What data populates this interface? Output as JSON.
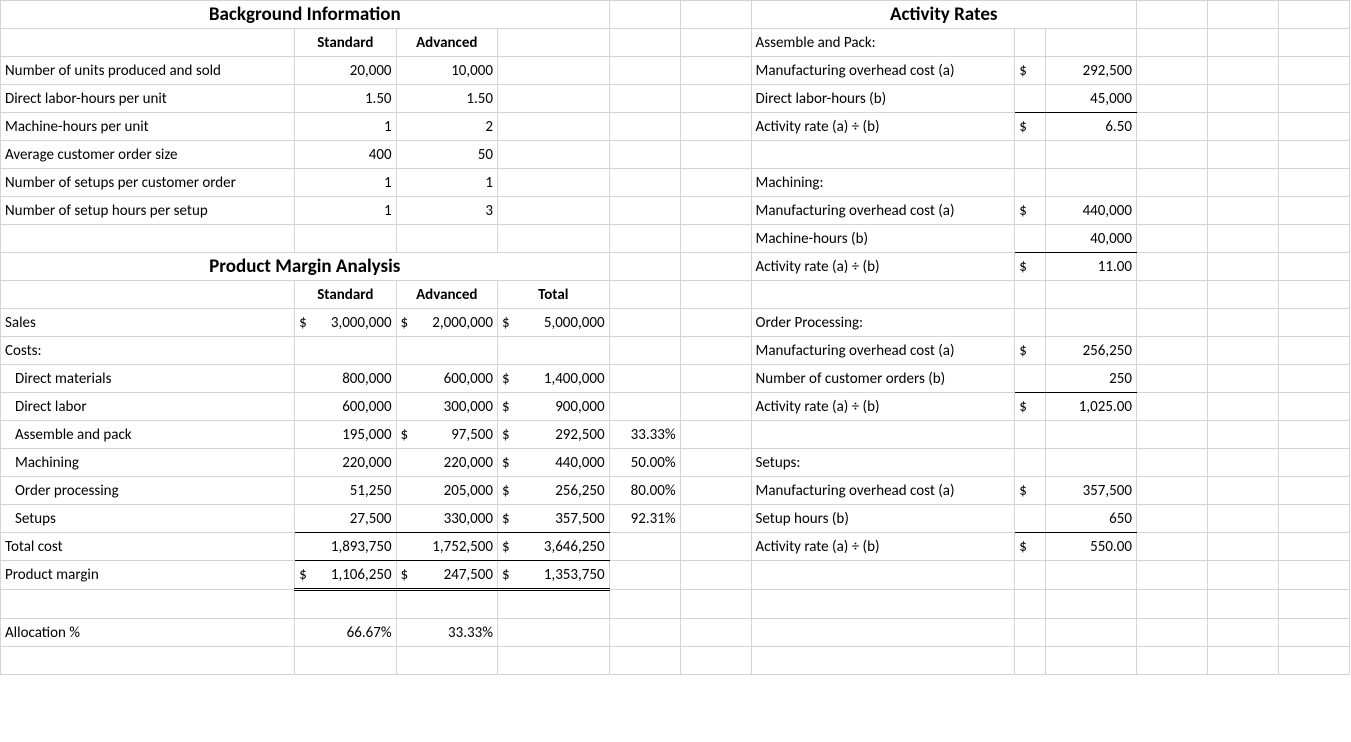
{
  "headings": {
    "bg": "Background Information",
    "pma": "Product Margin Analysis",
    "ar": "Activity Rates"
  },
  "cols": {
    "std": "Standard",
    "adv": "Advanced",
    "tot": "Total"
  },
  "bg": {
    "r1": {
      "label": "Number of units produced and sold",
      "std": "20,000",
      "adv": "10,000"
    },
    "r2": {
      "label": "Direct labor-hours per unit",
      "std": "1.50",
      "adv": "1.50"
    },
    "r3": {
      "label": "Machine-hours per unit",
      "std": "1",
      "adv": "2"
    },
    "r4": {
      "label": "Average customer order size",
      "std": "400",
      "adv": "50"
    },
    "r5": {
      "label": "Number of setups per customer order",
      "std": "1",
      "adv": "1"
    },
    "r6": {
      "label": "Number of setup hours per setup",
      "std": "1",
      "adv": "3"
    }
  },
  "pma": {
    "sales": {
      "label": "Sales",
      "std": "3,000,000",
      "adv": "2,000,000",
      "tot": "5,000,000"
    },
    "costs": {
      "label": "Costs:"
    },
    "dm": {
      "label": "Direct materials",
      "std": "800,000",
      "adv": "600,000",
      "tot": "1,400,000"
    },
    "dl": {
      "label": "Direct labor",
      "std": "600,000",
      "adv": "300,000",
      "tot": "900,000"
    },
    "ap": {
      "label": "Assemble and pack",
      "std": "195,000",
      "adv": "97,500",
      "tot": "292,500",
      "pct": "33.33%"
    },
    "mach": {
      "label": "Machining",
      "std": "220,000",
      "adv": "220,000",
      "tot": "440,000",
      "pct": "50.00%"
    },
    "op": {
      "label": "Order processing",
      "std": "51,250",
      "adv": "205,000",
      "tot": "256,250",
      "pct": "80.00%"
    },
    "su": {
      "label": "Setups",
      "std": "27,500",
      "adv": "330,000",
      "tot": "357,500",
      "pct": "92.31%"
    },
    "tc": {
      "label": "Total cost",
      "std": "1,893,750",
      "adv": "1,752,500",
      "tot": "3,646,250"
    },
    "pm": {
      "label": "Product margin",
      "std": "1,106,250",
      "adv": "247,500",
      "tot": "1,353,750"
    },
    "alloc": {
      "label": "Allocation %",
      "std": "66.67%",
      "adv": "33.33%"
    }
  },
  "ar": {
    "ap": {
      "title": "Assemble and Pack:",
      "a": {
        "label": "Manufacturing overhead cost (a)",
        "sym": "$",
        "val": "292,500"
      },
      "b": {
        "label": "Direct labor-hours (b)",
        "sym": "",
        "val": "45,000"
      },
      "r": {
        "label": "Activity rate (a) ÷ (b)",
        "sym": "$",
        "val": "6.50"
      }
    },
    "mach": {
      "title": "Machining:",
      "a": {
        "label": "Manufacturing overhead cost (a)",
        "sym": "$",
        "val": "440,000"
      },
      "b": {
        "label": "Machine-hours (b)",
        "sym": "",
        "val": "40,000"
      },
      "r": {
        "label": "Activity rate (a) ÷ (b)",
        "sym": "$",
        "val": "11.00"
      }
    },
    "op": {
      "title": "Order Processing:",
      "a": {
        "label": "Manufacturing overhead cost (a)",
        "sym": "$",
        "val": "256,250"
      },
      "b": {
        "label": "Number of customer orders (b)",
        "sym": "",
        "val": "250"
      },
      "r": {
        "label": "Activity rate (a) ÷ (b)",
        "sym": "$",
        "val": "1,025.00"
      }
    },
    "su": {
      "title": "Setups:",
      "a": {
        "label": "Manufacturing overhead cost (a)",
        "sym": "$",
        "val": "357,500"
      },
      "b": {
        "label": "Setup hours (b)",
        "sym": "",
        "val": "650"
      },
      "r": {
        "label": "Activity rate (a) ÷ (b)",
        "sym": "$",
        "val": "550.00"
      }
    }
  },
  "dollar": "$"
}
